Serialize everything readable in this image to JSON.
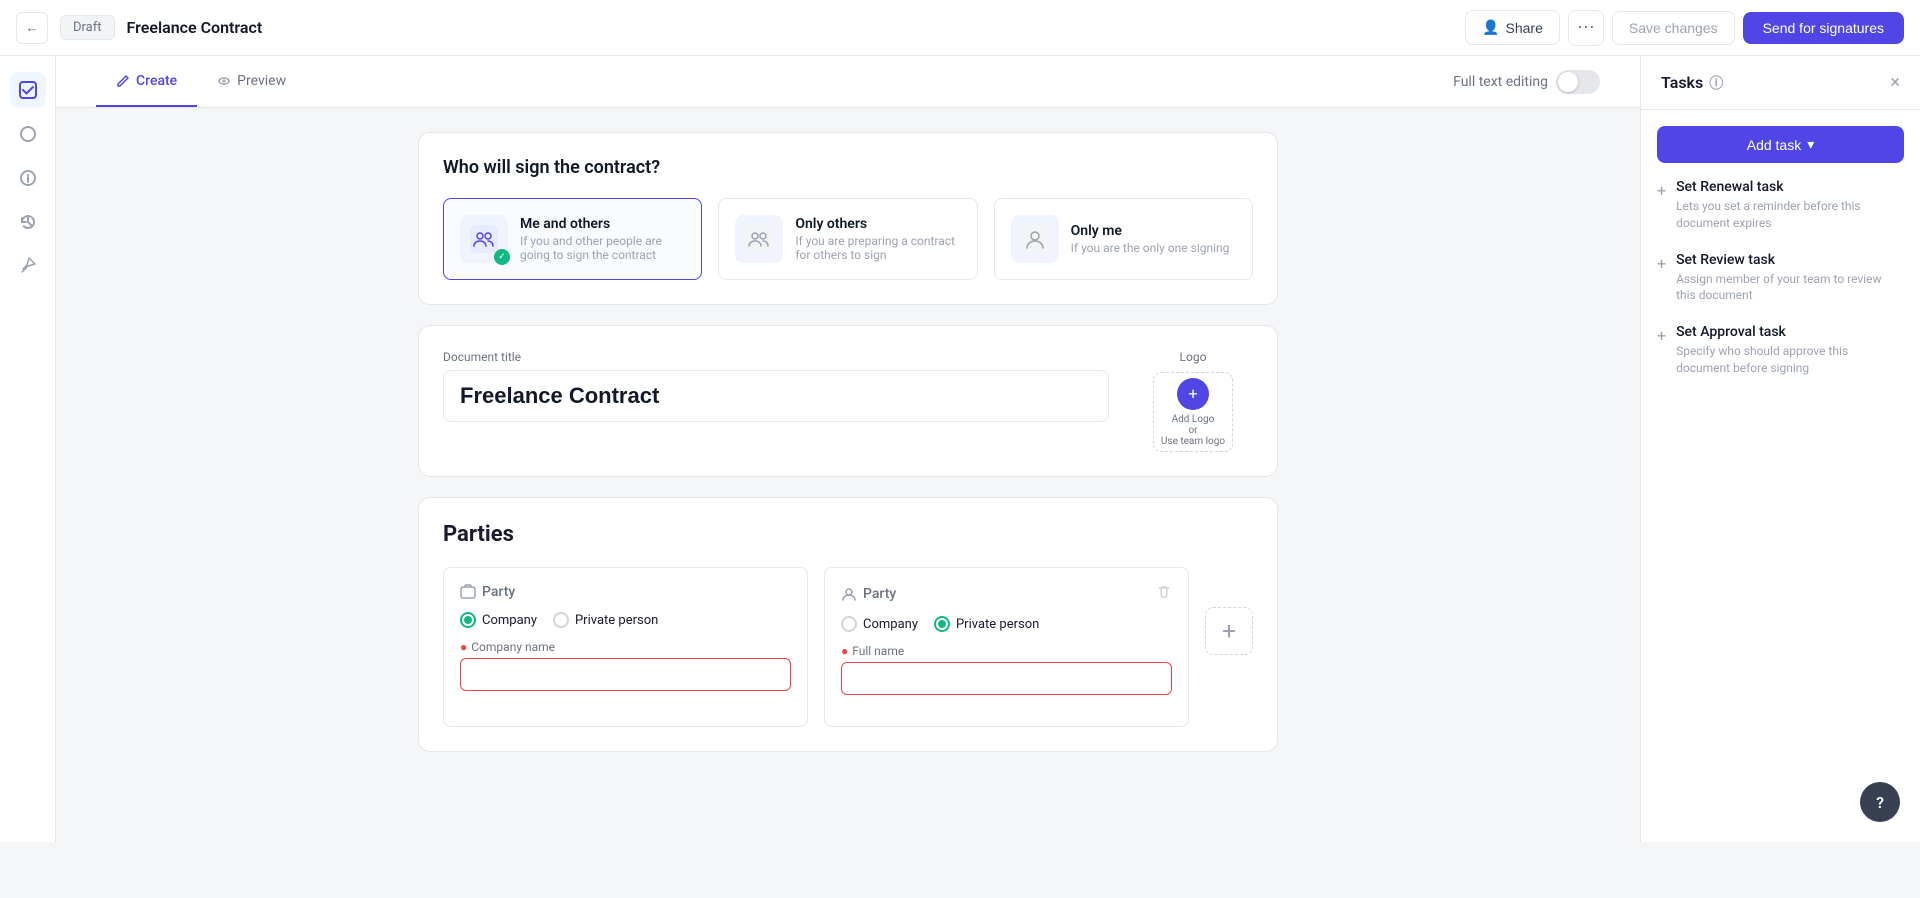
{
  "header": {
    "back_label": "←",
    "draft_label": "Draft",
    "doc_title": "Freelance Contract",
    "share_label": "Share",
    "more_label": "•••",
    "save_label": "Save changes",
    "send_label": "Send for signatures"
  },
  "tabs": {
    "create_label": "Create",
    "preview_label": "Preview",
    "full_text_label": "Full text editing"
  },
  "sign_section": {
    "title": "Who will sign the contract?",
    "options": [
      {
        "id": "me-and-others",
        "label": "Me and others",
        "desc": "If you and other people are going to sign the contract",
        "selected": true
      },
      {
        "id": "only-others",
        "label": "Only others",
        "desc": "If you are preparing a contract for others to sign",
        "selected": false
      },
      {
        "id": "only-me",
        "label": "Only me",
        "desc": "If you are the only one signing",
        "selected": false
      }
    ]
  },
  "document": {
    "title_label": "Document title",
    "title_value": "Freelance Contract",
    "logo_label": "Logo",
    "logo_add": "Add Logo",
    "logo_or": "or",
    "logo_team": "Use team logo"
  },
  "parties": {
    "section_title": "Parties",
    "party1": {
      "label": "Party",
      "type_company": "Company",
      "type_private": "Private person",
      "selected": "company",
      "field_label": "Company name",
      "required": true
    },
    "party2": {
      "label": "Party",
      "type_company": "Company",
      "type_private": "Private person",
      "selected": "private",
      "field_label": "Full name",
      "required": true
    }
  },
  "tasks_panel": {
    "title": "Tasks",
    "add_task_label": "Add task",
    "close_label": "×",
    "tasks": [
      {
        "label": "Set Renewal task",
        "desc": "Lets you set a reminder before this document expires"
      },
      {
        "label": "Set Review task",
        "desc": "Assign member of your team to review this document"
      },
      {
        "label": "Set Approval task",
        "desc": "Specify who should approve this document before signing"
      }
    ]
  },
  "help": {
    "label": "?"
  }
}
